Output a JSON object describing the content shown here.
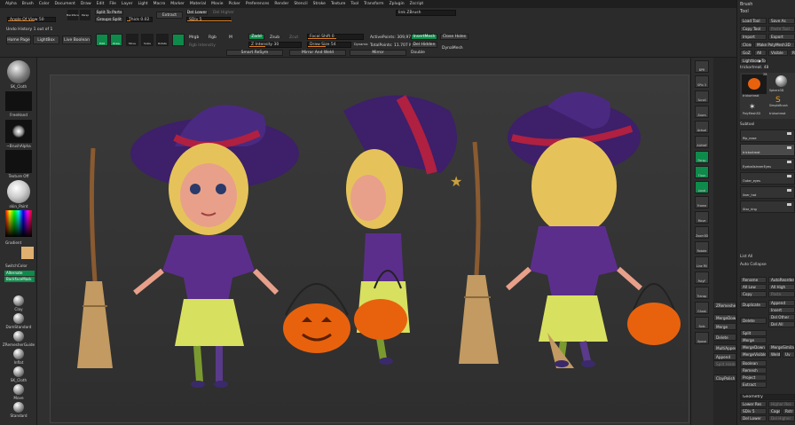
{
  "menu": [
    "Alpha",
    "Brush",
    "Color",
    "Document",
    "Draw",
    "Edit",
    "File",
    "Layer",
    "Light",
    "Macro",
    "Marker",
    "Material",
    "Movie",
    "Picker",
    "Preferences",
    "Render",
    "Stencil",
    "Stroke",
    "Texture",
    "Tool",
    "Transform",
    "Zplugin",
    "Zscript"
  ],
  "top": {
    "angle_of_view": "Angle Of View 50",
    "undo_history": "Undo History 1 out of 1",
    "home_page": "Home Page",
    "lightbox": "LightBox",
    "live_boolean": "Live Boolean",
    "backface": "Backface",
    "persp": "Persp",
    "floor": "Floor",
    "split_to_parts": "Split To Parts",
    "groups_split": "Groups Split",
    "extract": "Extract",
    "thick": "Thick 0.02",
    "del_lower": "Del Lower",
    "del_higher": "Del Higher",
    "sdiv": "SDiv 5",
    "link_zbrush": "link ZBrush",
    "edit": "Edit",
    "draw": "Draw",
    "move": "Move",
    "scale": "Scale",
    "rotate": "Rotate",
    "mrgb": "Mrgb",
    "rgb": "Rgb",
    "m": "M",
    "rgb_intensity": "Rgb Intensity",
    "zadd": "Zadd",
    "zsub": "Zsub",
    "zcut": "Zcut",
    "z_intensity": "Z Intensity 30",
    "focal_shift": "Focal Shift 0",
    "draw_size": "Draw Size 54",
    "dynamic": "Dynamic",
    "active_points": "ActivePoints: 309,977",
    "total_points": "TotalPoints: 11.707 Mil",
    "del_hidden": "Del Hidden",
    "close_holes": "Close Holes",
    "dynamesh": "DynaMesh",
    "insert_mesh": "InsertMesh",
    "double": "Double",
    "smart_resym": "Smart ReSym",
    "mirror_and_weld": "Mirror And Weld",
    "mirror": "Mirror"
  },
  "left": {
    "brush1": "SK_Cloth",
    "stroke": "FreeHand",
    "alpha": "~BrushAlpha",
    "texture": "Texture Off",
    "material": "skin_Paint",
    "gradient": "Gradient",
    "switch_color": "SwitchColor",
    "alternate": "Alternate",
    "backface_mask": "BackfaceMask",
    "brushes": [
      "Clay",
      "DamStandard",
      "ZRemesherGuide",
      "Inflat",
      "SK_Cloth",
      "Move",
      "Standard"
    ]
  },
  "right_shelf": [
    "BPR",
    "SPix 3",
    "Scroll",
    "Zoom",
    "Actual",
    "AAHalf",
    "Persp",
    "Floor",
    "Local",
    "Frame",
    "Move",
    "Zoom3D",
    "Rotate",
    "Line Fill",
    "PolyF",
    "Transp",
    "Ghost",
    "Solo",
    "Xpose"
  ],
  "palette": {
    "brush": "Brush",
    "tool": "Tool",
    "load_tool": "Load Tool",
    "save_as": "Save As",
    "copy_tool": "Copy Tool",
    "paste_tool": "Paste Tool",
    "import": "Import",
    "export": "Export",
    "clone": "Clone",
    "make_polymesh": "Make PolyMesh3D",
    "goz": "GoZ",
    "all": "All",
    "visible": "Visible",
    "r": "R",
    "lightbox_tools": "Lightbox▶Tools",
    "tool_name": "trickortreat. 48",
    "tool_count": "28",
    "thumbs": [
      "trickortreat",
      "Sphere3D",
      "SimpleBrush",
      "PolyMesh3D",
      "trickortreat"
    ],
    "subtool": "Subtool",
    "subtools": [
      "flip_nose",
      "trickortreat",
      "EyeballsInnerEyes",
      "Outer_eyes",
      "liner_hat",
      "Star_ring"
    ],
    "list_all": "List All",
    "auto_collapse": "Auto Collapse",
    "rename": "Rename",
    "auto_reorder": "AutoReorder",
    "all_low": "All Low",
    "all_high": "All High",
    "copy": "Copy",
    "paste": "Paste",
    "duplicate": "Duplicate",
    "append": "Append",
    "insert": "Insert",
    "delete": "Delete",
    "del_other": "Del Other",
    "del_all": "Del All",
    "split": "Split",
    "merge": "Merge",
    "merge_down": "MergeDown",
    "merge_similar": "MergeSimilar",
    "merge_visible": "MergeVisible",
    "weld": "Weld",
    "uv": "Uv",
    "boolean": "Boolean",
    "remesh": "Remesh",
    "project": "Project",
    "extract": "Extract",
    "geometry": "Geometry",
    "lower_res": "Lower Res",
    "higher_res": "Higher Res",
    "sdiv": "SDiv 5",
    "cage": "Cage",
    "rstr": "Rstr",
    "del_lower": "Del Lower",
    "del_higher": "Del Higher"
  },
  "mid": {
    "zremesher": "ZRemesher",
    "merge_down": "MergeDown",
    "merge": "Merge",
    "delete": "Delete",
    "multi_append": "MultiAppend",
    "append": "Append",
    "split_hidden": "Split Hidden",
    "clay_polish": "ClayPolish"
  },
  "colors": {
    "accent": "#e08020",
    "green": "#0e8a4a",
    "dress": "#5b2e8c",
    "skirt": "#d8e060",
    "pumpkin": "#e8620e",
    "hat": "#3d1f6a",
    "hair": "#e6c35a"
  }
}
